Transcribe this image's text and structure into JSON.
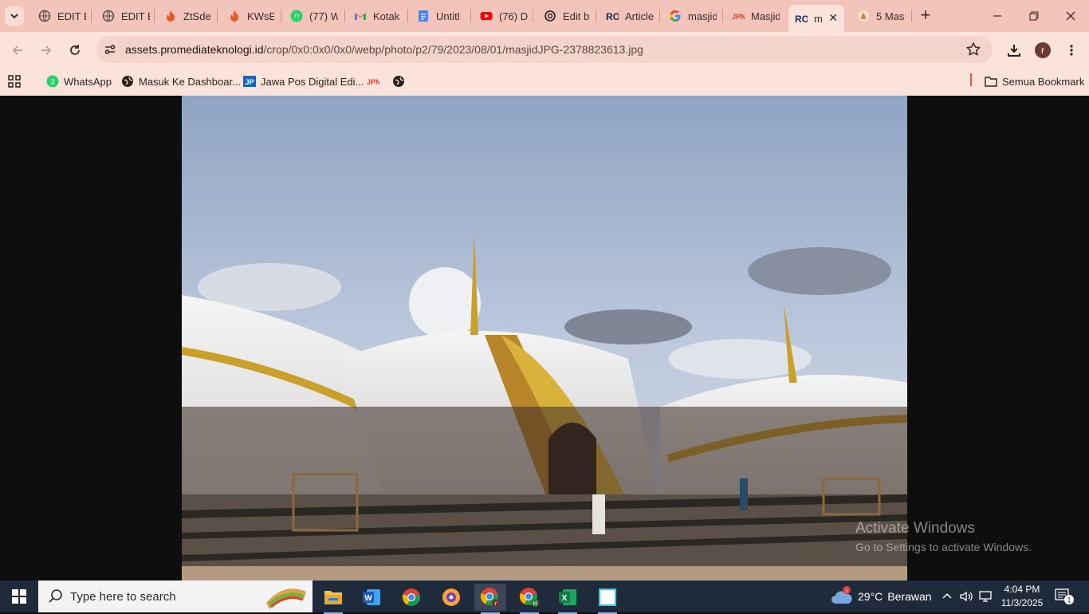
{
  "browser": {
    "tabs": [
      {
        "title": "EDIT E",
        "icon": "globe-icon"
      },
      {
        "title": "EDIT E",
        "icon": "globe-icon"
      },
      {
        "title": "ZtSde",
        "icon": "flame-icon"
      },
      {
        "title": "KWsE(",
        "icon": "flame-icon"
      },
      {
        "title": "(77) W",
        "icon": "whatsapp-icon"
      },
      {
        "title": "Kotak",
        "icon": "gmail-icon"
      },
      {
        "title": "Untitl",
        "icon": "docs-icon"
      },
      {
        "title": "(76) D",
        "icon": "youtube-icon"
      },
      {
        "title": "Edit b",
        "icon": "openai-icon"
      },
      {
        "title": "Article",
        "icon": "ro-icon"
      },
      {
        "title": "masjid",
        "icon": "google-icon"
      },
      {
        "title": "Masjid",
        "icon": "jawapos-icon"
      },
      {
        "title": "m",
        "icon": "ro-icon",
        "active": true
      },
      {
        "title": "5 Mas",
        "icon": "site-icon"
      }
    ],
    "address": {
      "host": "assets.promediateknologi.id",
      "path": "/crop/0x0:0x0/0x0/webp/photo/p2/79/2023/08/01/masjidJPG-2378823613.jpg"
    },
    "profile_initial": "r",
    "bookmarks": [
      {
        "label": "WhatsApp",
        "icon": "whatsapp-icon",
        "badge": "3"
      },
      {
        "label": "Masuk Ke Dashboar...",
        "icon": "globe-icon"
      },
      {
        "label": "Jawa Pos Digital Edi...",
        "icon": "jp-icon"
      },
      {
        "label": "",
        "icon": "jawapos-icon"
      },
      {
        "label": "",
        "icon": "globe-icon"
      }
    ],
    "all_bookmarks": "Semua Bookmark"
  },
  "watermark": {
    "line1": "Activate Windows",
    "line2": "Go to Settings to activate Windows."
  },
  "taskbar": {
    "search_placeholder": "Type here to search",
    "apps": [
      "file-explorer-icon",
      "word-icon",
      "chrome-icon",
      "brave-icon",
      "chrome-profile-r-icon",
      "chrome-profile-h-icon",
      "excel-icon",
      "notepad-icon"
    ],
    "weather": {
      "badge": "1",
      "temp": "29°C",
      "desc": "Berawan"
    },
    "time": "4:04 PM",
    "date": "11/3/2025",
    "notifications": "1"
  },
  "colors": {
    "tabstrip": "#f2c4ba",
    "toolbar": "#fbe3dc",
    "taskbar": "#1f2a3a"
  }
}
